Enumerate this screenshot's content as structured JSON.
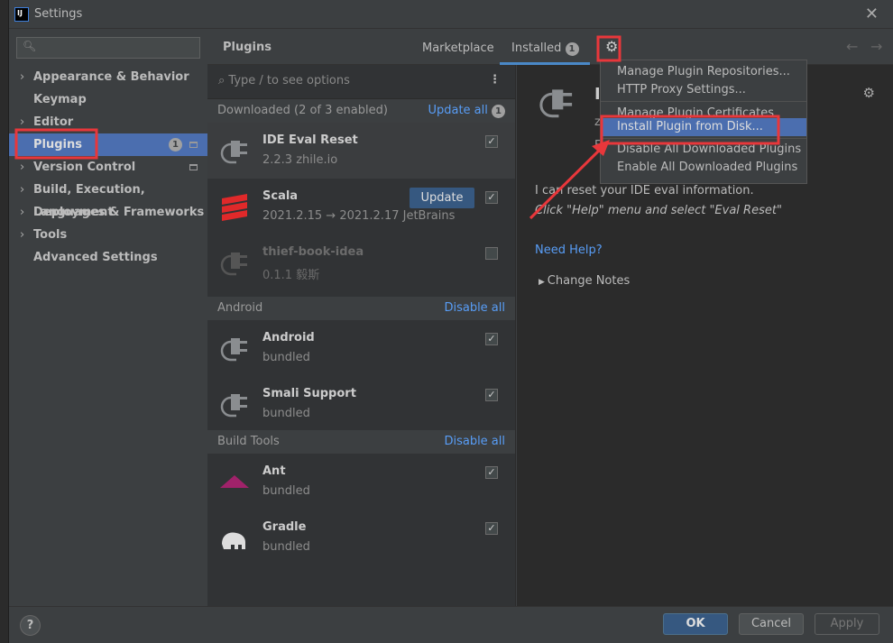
{
  "window": {
    "title": "Settings",
    "logo": "IJ",
    "close": "✕"
  },
  "sidebar": {
    "search_placeholder": "",
    "items": [
      {
        "label": "Appearance & Behavior",
        "expandable": true
      },
      {
        "label": "Keymap",
        "expandable": false
      },
      {
        "label": "Editor",
        "expandable": true
      },
      {
        "label": "Plugins",
        "expandable": false,
        "badge": "1",
        "selected": true
      },
      {
        "label": "Version Control",
        "expandable": true
      },
      {
        "label": "Build, Execution, Deployment",
        "expandable": true
      },
      {
        "label": "Languages & Frameworks",
        "expandable": true
      },
      {
        "label": "Tools",
        "expandable": true
      },
      {
        "label": "Advanced Settings",
        "expandable": false
      }
    ]
  },
  "header": {
    "title": "Plugins",
    "tabs": [
      {
        "label": "Marketplace"
      },
      {
        "label": "Installed",
        "badge": "1",
        "active": true
      }
    ]
  },
  "list": {
    "search_placeholder": "Type / to see options",
    "groups": [
      {
        "title": "Downloaded (2 of 3 enabled)",
        "action": "Update all",
        "badge": "1"
      },
      {
        "title": "Android",
        "action": "Disable all"
      },
      {
        "title": "Build Tools",
        "action": "Disable all"
      }
    ],
    "plugins": [
      {
        "name": "IDE Eval Reset",
        "sub": "2.2.3  zhile.io",
        "checked": true
      },
      {
        "name": "Scala",
        "sub": "2021.2.15 → 2021.2.17  JetBrains",
        "checked": true,
        "button": "Update"
      },
      {
        "name": "thief-book-idea",
        "sub": "0.1.1  毅斯",
        "checked": false
      },
      {
        "name": "Android",
        "sub": "bundled",
        "checked": true
      },
      {
        "name": "Smali Support",
        "sub": "bundled",
        "checked": true
      },
      {
        "name": "Ant",
        "sub": "bundled",
        "checked": true
      },
      {
        "name": "Gradle",
        "sub": "bundled",
        "checked": true
      }
    ]
  },
  "detail": {
    "title_partial": "I",
    "line_z": "z",
    "line_e": "E",
    "description": "I can reset your IDE eval information.",
    "instruction": "Click \"Help\" menu and select \"Eval Reset\"",
    "help_link": "Need Help?",
    "change_notes": "Change Notes"
  },
  "menu": {
    "items": [
      "Manage Plugin Repositories...",
      "HTTP Proxy Settings...",
      "Manage Plugin Certificates",
      "Install Plugin from Disk...",
      "Disable All Downloaded Plugins",
      "Enable All Downloaded Plugins"
    ],
    "highlighted": "Install Plugin from Disk..."
  },
  "footer": {
    "help": "?",
    "ok": "OK",
    "cancel": "Cancel",
    "apply": "Apply"
  },
  "colors": {
    "accent": "#4b6eaf",
    "link": "#589df6",
    "annotation": "#e8373b"
  }
}
